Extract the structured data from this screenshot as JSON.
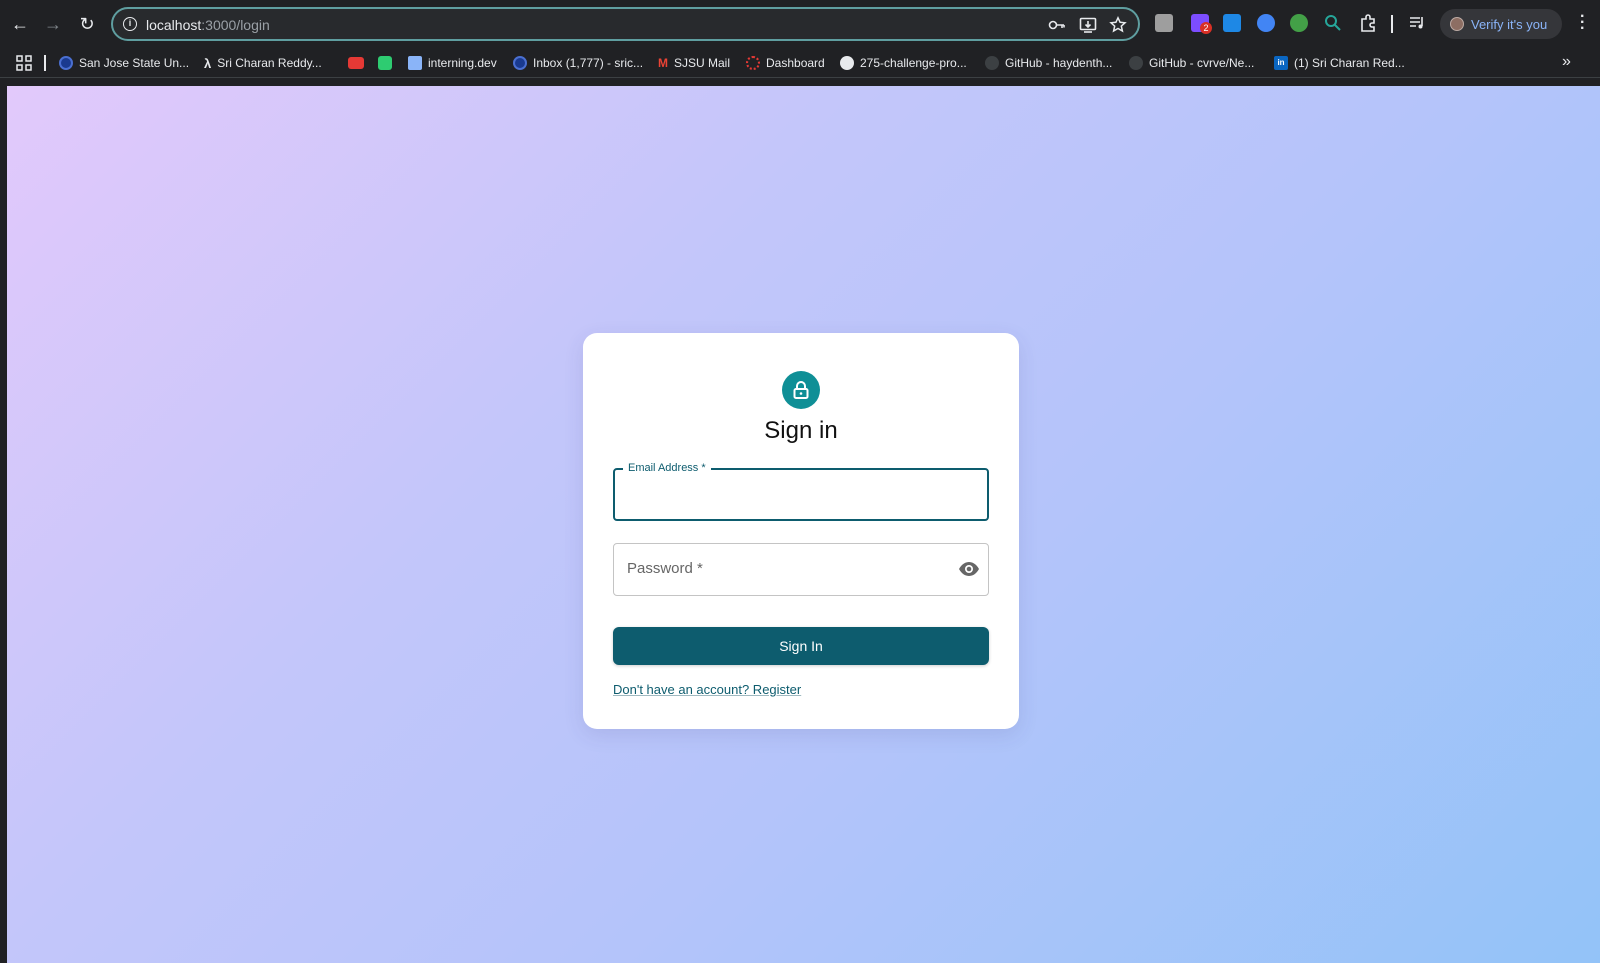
{
  "browser": {
    "url_host": "localhost",
    "url_path": ":3000/login",
    "verify_label": "Verify it's you",
    "bookmarks": [
      {
        "label": "San Jose State Un...",
        "color": "#1a3a8f"
      },
      {
        "label": "Sri Charan Reddy...",
        "color": "#202124"
      },
      {
        "label": "",
        "color": "#e53935"
      },
      {
        "label": "",
        "color": "#2ecc71"
      },
      {
        "label": "interning.dev",
        "color": "#8ab4f8"
      },
      {
        "label": "Inbox (1,777) - sric...",
        "color": "#1a3a8f"
      },
      {
        "label": "SJSU Mail",
        "color": "#ea4335"
      },
      {
        "label": "Dashboard",
        "color": "#e53935"
      },
      {
        "label": "275-challenge-pro...",
        "color": "#e8eaed"
      },
      {
        "label": "GitHub - haydenth...",
        "color": "#444"
      },
      {
        "label": "GitHub - cvrve/Ne...",
        "color": "#444"
      },
      {
        "label": "(1) Sri Charan Red...",
        "color": "#0a66c2"
      }
    ],
    "extension_badge": "2"
  },
  "login": {
    "title": "Sign in",
    "email_label": "Email Address *",
    "email_value": "",
    "password_label": "Password *",
    "button_label": "Sign In",
    "register_link": "Don't have an account? Register"
  },
  "colors": {
    "primary": "#0d5c6e",
    "lock_circle": "#0f8f96"
  }
}
